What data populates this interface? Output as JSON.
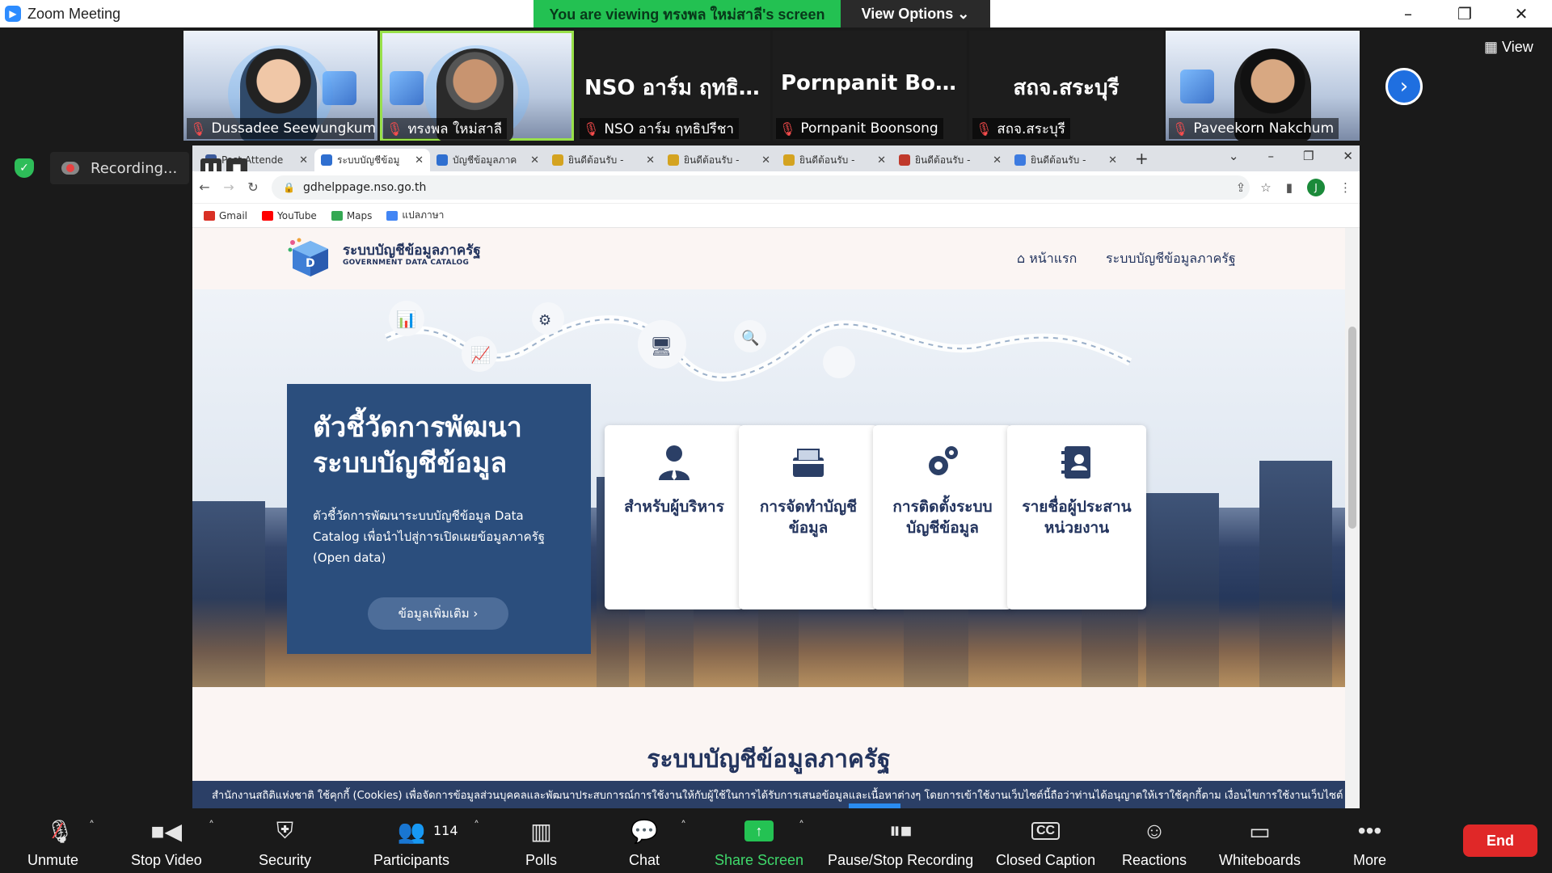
{
  "zoom": {
    "window_title": "Zoom Meeting",
    "viewing_banner": "You are viewing ทรงพล ใหม่สาลี's screen",
    "view_options": "View Options ⌄",
    "view_label": "View",
    "recording_label": "Recording..."
  },
  "participants": [
    {
      "name": "Dussadee Seewungkum",
      "video": true
    },
    {
      "name": "ทรงพล ใหม่สาลี",
      "video": true,
      "active": true
    },
    {
      "display": "NSO อาร์ม ฤทธิ...",
      "name": "NSO อาร์ม ฤทธิปรีชา",
      "video": false
    },
    {
      "display": "Pornpanit Boon...",
      "name": "Pornpanit Boonsong",
      "video": false
    },
    {
      "display": "สถจ.สระบุรี",
      "name": "สถจ.สระบุรี",
      "video": false
    },
    {
      "name": "Paveekorn Nakchum",
      "video": true
    }
  ],
  "browser": {
    "tabs": [
      {
        "label": "Post Attende",
        "color": "#3c5a9a"
      },
      {
        "label": "ระบบบัญชีข้อมู",
        "color": "#2f6fd0",
        "active": true
      },
      {
        "label": "บัญชีข้อมูลภาค",
        "color": "#2f6fd0"
      },
      {
        "label": "ยินดีต้อนรับ - ",
        "color": "#d4a320"
      },
      {
        "label": "ยินดีต้อนรับ - ",
        "color": "#d4a320"
      },
      {
        "label": "ยินดีต้อนรับ - ",
        "color": "#d4a320"
      },
      {
        "label": "ยินดีต้อนรับ - ",
        "color": "#c0392b"
      },
      {
        "label": "ยินดีต้อนรับ - ",
        "color": "#3d7be0"
      }
    ],
    "url": "gdhelppage.nso.go.th",
    "profile_initial": "J",
    "bookmarks": [
      {
        "label": "Gmail",
        "color": "#d93025"
      },
      {
        "label": "YouTube",
        "color": "#ff0000"
      },
      {
        "label": "Maps",
        "color": "#34a853"
      },
      {
        "label": "แปลภาษา",
        "color": "#4285f4"
      }
    ]
  },
  "site": {
    "logo_th": "ระบบบัญชีข้อมูลภาครัฐ",
    "logo_en": "GOVERNMENT DATA CATALOG",
    "nav_home": "หน้าแรก",
    "nav_catalog": "ระบบบัญชีข้อมูลภาครัฐ",
    "hero_title": "ตัวชี้วัดการพัฒนาระบบบัญชีข้อมูล",
    "hero_desc": "ตัวชี้วัดการพัฒนาระบบบัญชีข้อมูล Data Catalog เพื่อนำไปสู่การเปิดเผยข้อมูลภาครัฐ (Open data)",
    "hero_button": "ข้อมูลเพิ่มเติม ›",
    "cards": [
      {
        "label": "สำหรับผู้บริหาร",
        "icon": "executive-icon"
      },
      {
        "label": "การจัดทำบัญชีข้อมูล",
        "icon": "folder-icon"
      },
      {
        "label": "การติดตั้งระบบบัญชีข้อมูล",
        "icon": "gears-icon"
      },
      {
        "label": "รายชื่อผู้ประสานหน่วยงาน",
        "icon": "contact-book-icon"
      }
    ],
    "section_title": "ระบบบัญชีข้อมูลภาครัฐ",
    "cookie_text": "สำนักงานสถิติแห่งชาติ ใช้คุกกี้ (Cookies) เพื่อจัดการข้อมูลส่วนบุคคลและพัฒนาประสบการณ์การใช้งานให้กับผู้ใช้ในการได้รับการเสนอข้อมูลและเนื้อหาต่างๆ โดยการเข้าใช้งานเว็บไซต์นี้ถือว่าท่านได้อนุญาตให้เราใช้คุกกี้ตาม เงื่อนไขการใช้งานเว็บไซต์"
  },
  "toolbar": {
    "unmute": "Unmute",
    "stop_video": "Stop Video",
    "security": "Security",
    "participants": "Participants",
    "participants_count": "114",
    "polls": "Polls",
    "chat": "Chat",
    "share_screen": "Share Screen",
    "pause_recording": "Pause/Stop Recording",
    "closed_caption": "Closed Caption",
    "reactions": "Reactions",
    "whiteboards": "Whiteboards",
    "more": "More",
    "end": "End"
  }
}
